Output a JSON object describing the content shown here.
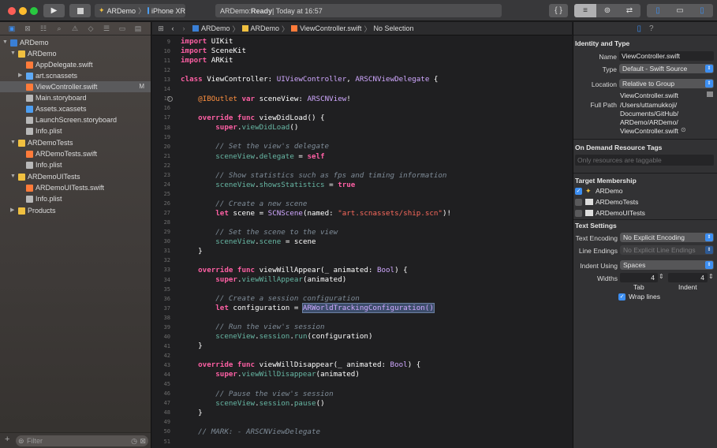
{
  "toolbar": {
    "scheme": "ARDemo",
    "device": "iPhone XR",
    "status_app": "ARDemo: ",
    "status_state": "Ready",
    "status_time": " | Today at 16:57"
  },
  "navigator": {
    "rows": [
      {
        "label": "ARDemo"
      },
      {
        "label": "ARDemo"
      },
      {
        "label": "AppDelegate.swift"
      },
      {
        "label": "art.scnassets"
      },
      {
        "label": "ViewController.swift",
        "badge": "M"
      },
      {
        "label": "Main.storyboard"
      },
      {
        "label": "Assets.xcassets"
      },
      {
        "label": "LaunchScreen.storyboard"
      },
      {
        "label": "Info.plist"
      },
      {
        "label": "ARDemoTests"
      },
      {
        "label": "ARDemoTests.swift"
      },
      {
        "label": "Info.plist"
      },
      {
        "label": "ARDemoUITests"
      },
      {
        "label": "ARDemoUITests.swift"
      },
      {
        "label": "Info.plist"
      },
      {
        "label": "Products"
      }
    ],
    "filter_placeholder": "Filter"
  },
  "jumpbar": {
    "crumbs": [
      "ARDemo",
      "ARDemo",
      "ViewController.swift",
      "No Selection"
    ]
  },
  "editor": {
    "line_numbers": [
      "9",
      "10",
      "11",
      "12",
      "13",
      "14",
      "15",
      "16",
      "17",
      "18",
      "19",
      "20",
      "21",
      "22",
      "23",
      "24",
      "25",
      "26",
      "27",
      "28",
      "29",
      "30",
      "31",
      "32",
      "33",
      "34",
      "35",
      "36",
      "37",
      "38",
      "39",
      "40",
      "41",
      "42",
      "43",
      "44",
      "45",
      "46",
      "47",
      "48",
      "49",
      "50",
      "51"
    ]
  },
  "inspector": {
    "section_identity": "Identity and Type",
    "name_label": "Name",
    "name_value": "ViewController.swift",
    "type_label": "Type",
    "type_value": "Default - Swift Source",
    "location_label": "Location",
    "location_value": "Relative to Group",
    "location_file": "ViewController.swift",
    "fullpath_label": "Full Path",
    "fullpath_lines": [
      "/Users/uttamukkoji/",
      "Documents/GitHub/",
      "ARDemo/ARDemo/",
      "ViewController.swift"
    ],
    "section_odr": "On Demand Resource Tags",
    "odr_placeholder": "Only resources are taggable",
    "section_target": "Target Membership",
    "targets": [
      "ARDemo",
      "ARDemoTests",
      "ARDemoUITests"
    ],
    "section_text": "Text Settings",
    "encoding_label": "Text Encoding",
    "encoding_value": "No Explicit Encoding",
    "endings_label": "Line Endings",
    "endings_value": "No Explicit Line Endings",
    "indent_label": "Indent Using",
    "indent_value": "Spaces",
    "widths_label": "Widths",
    "tab_value": "4",
    "indent_width_value": "4",
    "tab_caption": "Tab",
    "indent_caption": "Indent",
    "wrap_label": "Wrap lines"
  },
  "colors": {
    "accent": "#3d8ff2",
    "keyword": "#fc5fa3",
    "type": "#5dd8ff",
    "comment": "#7f8c98",
    "string": "#fc6a5d"
  }
}
